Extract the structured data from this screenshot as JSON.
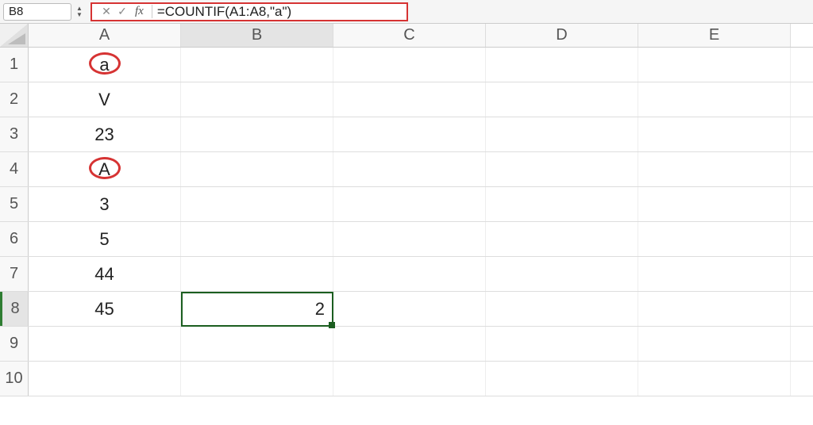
{
  "name_box": "B8",
  "formula_bar": {
    "cancel_glyph": "✕",
    "confirm_glyph": "✓",
    "fx_label": "fx",
    "formula": "=COUNTIF(A1:A8,\"a\")"
  },
  "columns": [
    "A",
    "B",
    "C",
    "D",
    "E"
  ],
  "active_column_index": 1,
  "rows": [
    {
      "n": "1",
      "A": "a",
      "B": ""
    },
    {
      "n": "2",
      "A": "V",
      "B": ""
    },
    {
      "n": "3",
      "A": "23",
      "B": ""
    },
    {
      "n": "4",
      "A": "A",
      "B": ""
    },
    {
      "n": "5",
      "A": "3",
      "B": ""
    },
    {
      "n": "6",
      "A": "5",
      "B": ""
    },
    {
      "n": "7",
      "A": "44",
      "B": ""
    },
    {
      "n": "8",
      "A": "45",
      "B": "2"
    },
    {
      "n": "9",
      "A": "",
      "B": ""
    },
    {
      "n": "10",
      "A": "",
      "B": ""
    }
  ],
  "active_row_index": 7,
  "selection": {
    "col": "B",
    "row": 8
  },
  "annotations": {
    "circled_cells": [
      "A1",
      "A4"
    ],
    "highlight_formula_bar": true
  }
}
